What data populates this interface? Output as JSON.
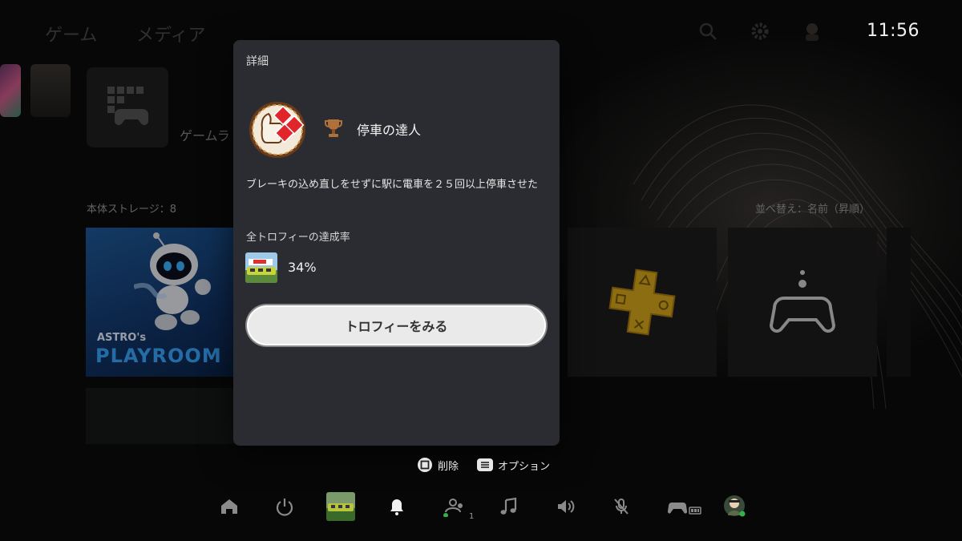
{
  "header": {
    "tab_games": "ゲーム",
    "tab_media": "メディア",
    "clock": "11:56"
  },
  "home": {
    "library_label": "ゲームラ",
    "storage_label": "本体ストレージ：8",
    "sort_label": "並べ替え：名前（昇順）",
    "featured_game": {
      "title_line1": "ASTRO's",
      "title_line2": "PLAYROOM"
    }
  },
  "popup": {
    "title": "詳細",
    "trophy": {
      "tier": "bronze",
      "name": "停車の達人",
      "description": "ブレーキの込め直しをせずに駅に電車を２５回以上停車させた"
    },
    "rate_label": "全トロフィーの達成率",
    "rate_value": "34%",
    "view_button_label": "トロフィーをみる"
  },
  "hints": {
    "delete_label": "削除",
    "options_label": "オプション"
  },
  "control_center": {
    "party_count": "1",
    "items": [
      "home-icon",
      "power-icon",
      "current-game",
      "notifications-icon",
      "game-base-icon",
      "music-icon",
      "sound-icon",
      "mic-muted-icon",
      "accessories-icon",
      "profile-avatar"
    ]
  },
  "colors": {
    "popup_bg": "#2b2c31",
    "bronze": "#b0703a",
    "button_bg": "#eaeaea"
  }
}
